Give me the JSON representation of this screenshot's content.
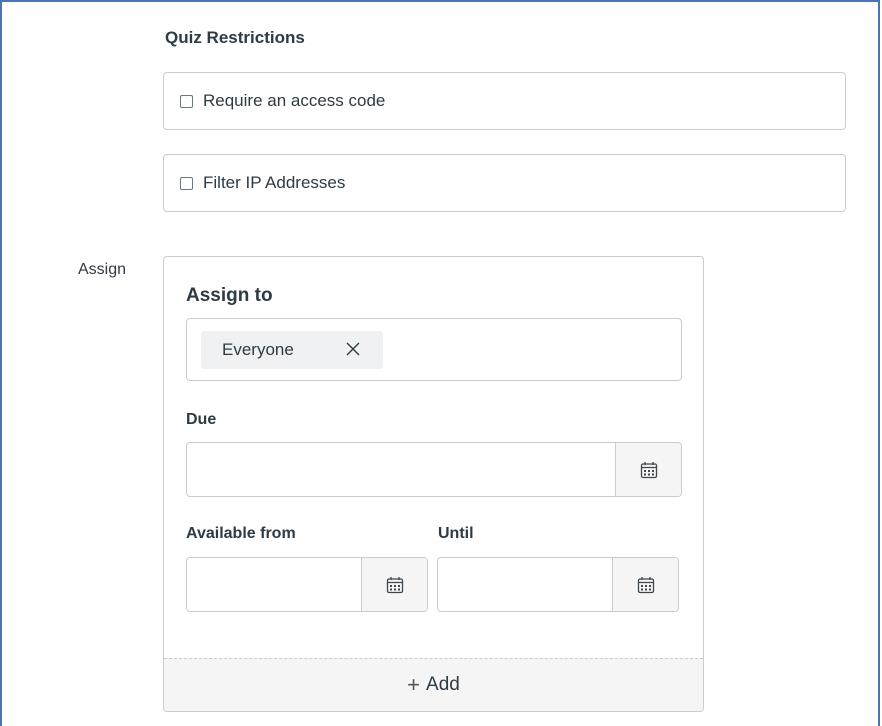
{
  "quiz_restrictions": {
    "title": "Quiz Restrictions",
    "items": [
      {
        "label": "Require an access code",
        "checked": false
      },
      {
        "label": "Filter IP Addresses",
        "checked": false
      }
    ]
  },
  "assign": {
    "side_label": "Assign",
    "assign_to_title": "Assign to",
    "assignees": [
      {
        "label": "Everyone"
      }
    ],
    "due_label": "Due",
    "due_value": "",
    "available_from_label": "Available from",
    "available_from_value": "",
    "until_label": "Until",
    "until_value": "",
    "add_label": "Add",
    "add_icon": "+"
  },
  "icons": {
    "calendar": "calendar-icon",
    "close": "x-icon",
    "checkbox": "checkbox-icon"
  }
}
